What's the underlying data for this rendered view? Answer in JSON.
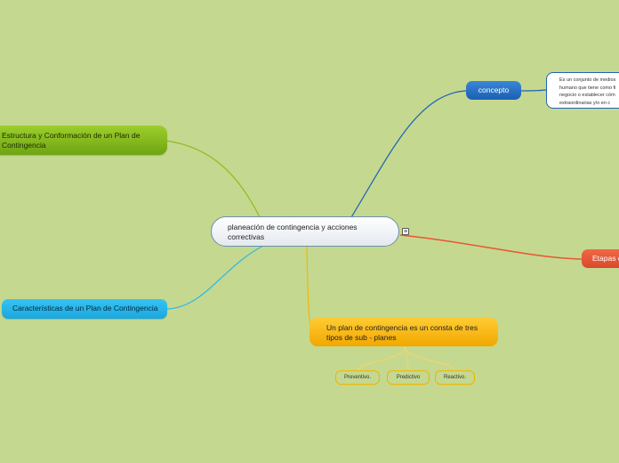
{
  "central": {
    "label": "planeación de contingencia y acciones correctivas",
    "menu_glyph": "≡"
  },
  "branches": {
    "estructura": {
      "label": "Estructura y Conformación de un Plan de Contingencia",
      "color": "#86bb1f"
    },
    "caracteristicas": {
      "label": "Características de un Plan de Contingencia",
      "color": "#29b5e8"
    },
    "concepto": {
      "label": "concepto",
      "color": "#1f63b8",
      "detail": "Es un conjunto de medios\nhumano que tiene como fi\nnegocio o establecer cóm\nextraordinarias y/o en c"
    },
    "etapas": {
      "label": "Etapas d",
      "color": "#e85535"
    },
    "tipos": {
      "label": "Un plan de contingencia es un consta de tres tipos de sub - planes",
      "color": "#f5b800",
      "children": [
        "Preventivo.",
        "Predictivo",
        "Reactivo."
      ]
    }
  }
}
